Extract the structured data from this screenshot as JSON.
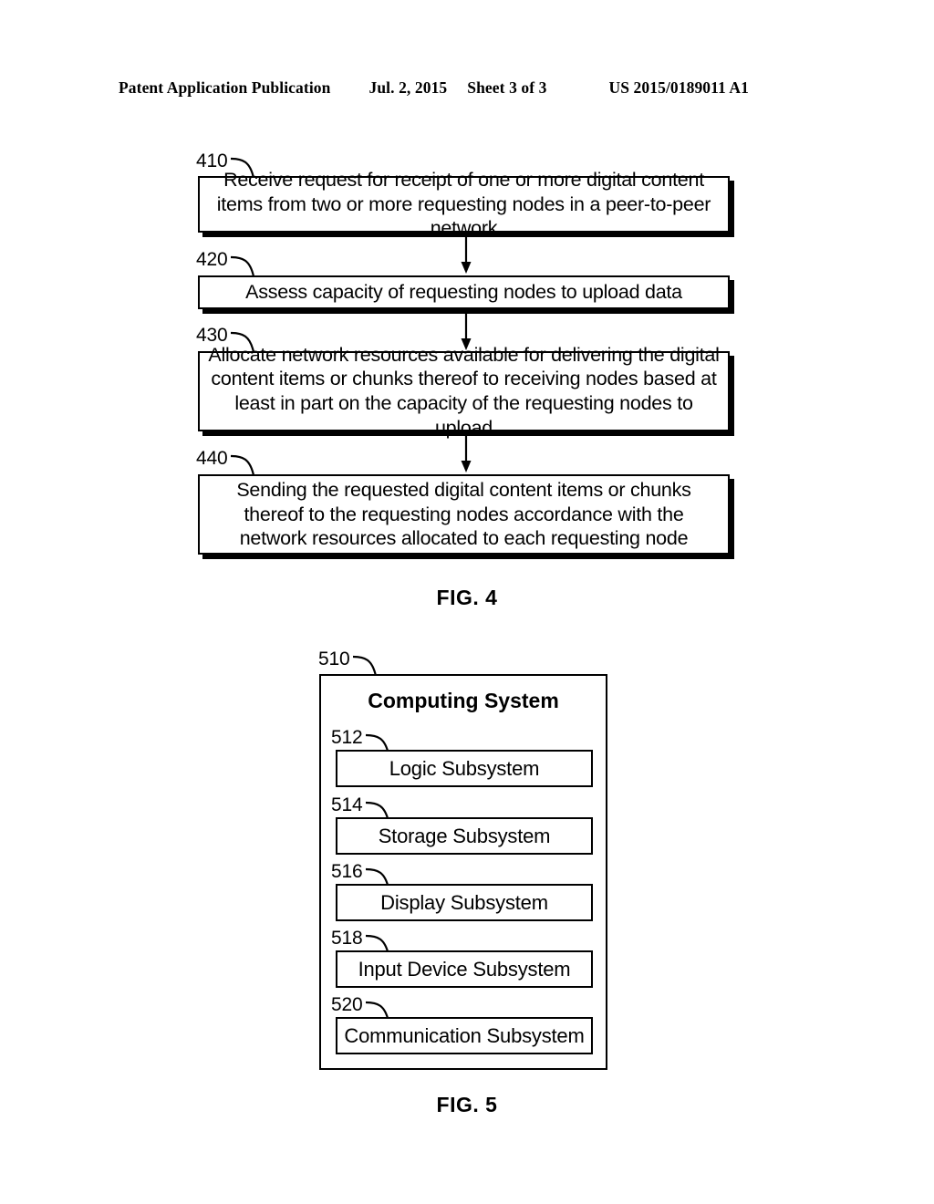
{
  "header": {
    "publication": "Patent Application Publication",
    "date": "Jul. 2, 2015",
    "sheet": "Sheet 3 of 3",
    "patent_number": "US 2015/0189011 A1"
  },
  "figure4": {
    "caption": "FIG. 4",
    "steps": [
      {
        "ref": "410",
        "text": "Receive request for receipt of one or more digital content items from two or more requesting nodes in a peer-to-peer network"
      },
      {
        "ref": "420",
        "text": "Assess capacity of requesting nodes to upload data"
      },
      {
        "ref": "430",
        "text": "Allocate network resources available for delivering the digital content items or chunks thereof to receiving nodes based at least in part on the capacity of the requesting nodes to upload"
      },
      {
        "ref": "440",
        "text": "Sending the requested digital content items or chunks thereof to the requesting nodes accordance with the network resources allocated to each requesting node"
      }
    ]
  },
  "figure5": {
    "caption": "FIG. 5",
    "ref": "510",
    "title": "Computing System",
    "subsystems": [
      {
        "ref": "512",
        "label": "Logic Subsystem"
      },
      {
        "ref": "514",
        "label": "Storage Subsystem"
      },
      {
        "ref": "516",
        "label": "Display Subsystem"
      },
      {
        "ref": "518",
        "label": "Input Device Subsystem"
      },
      {
        "ref": "520",
        "label": "Communication Subsystem"
      }
    ]
  },
  "colors": {
    "ink": "#000000",
    "paper": "#ffffff"
  }
}
